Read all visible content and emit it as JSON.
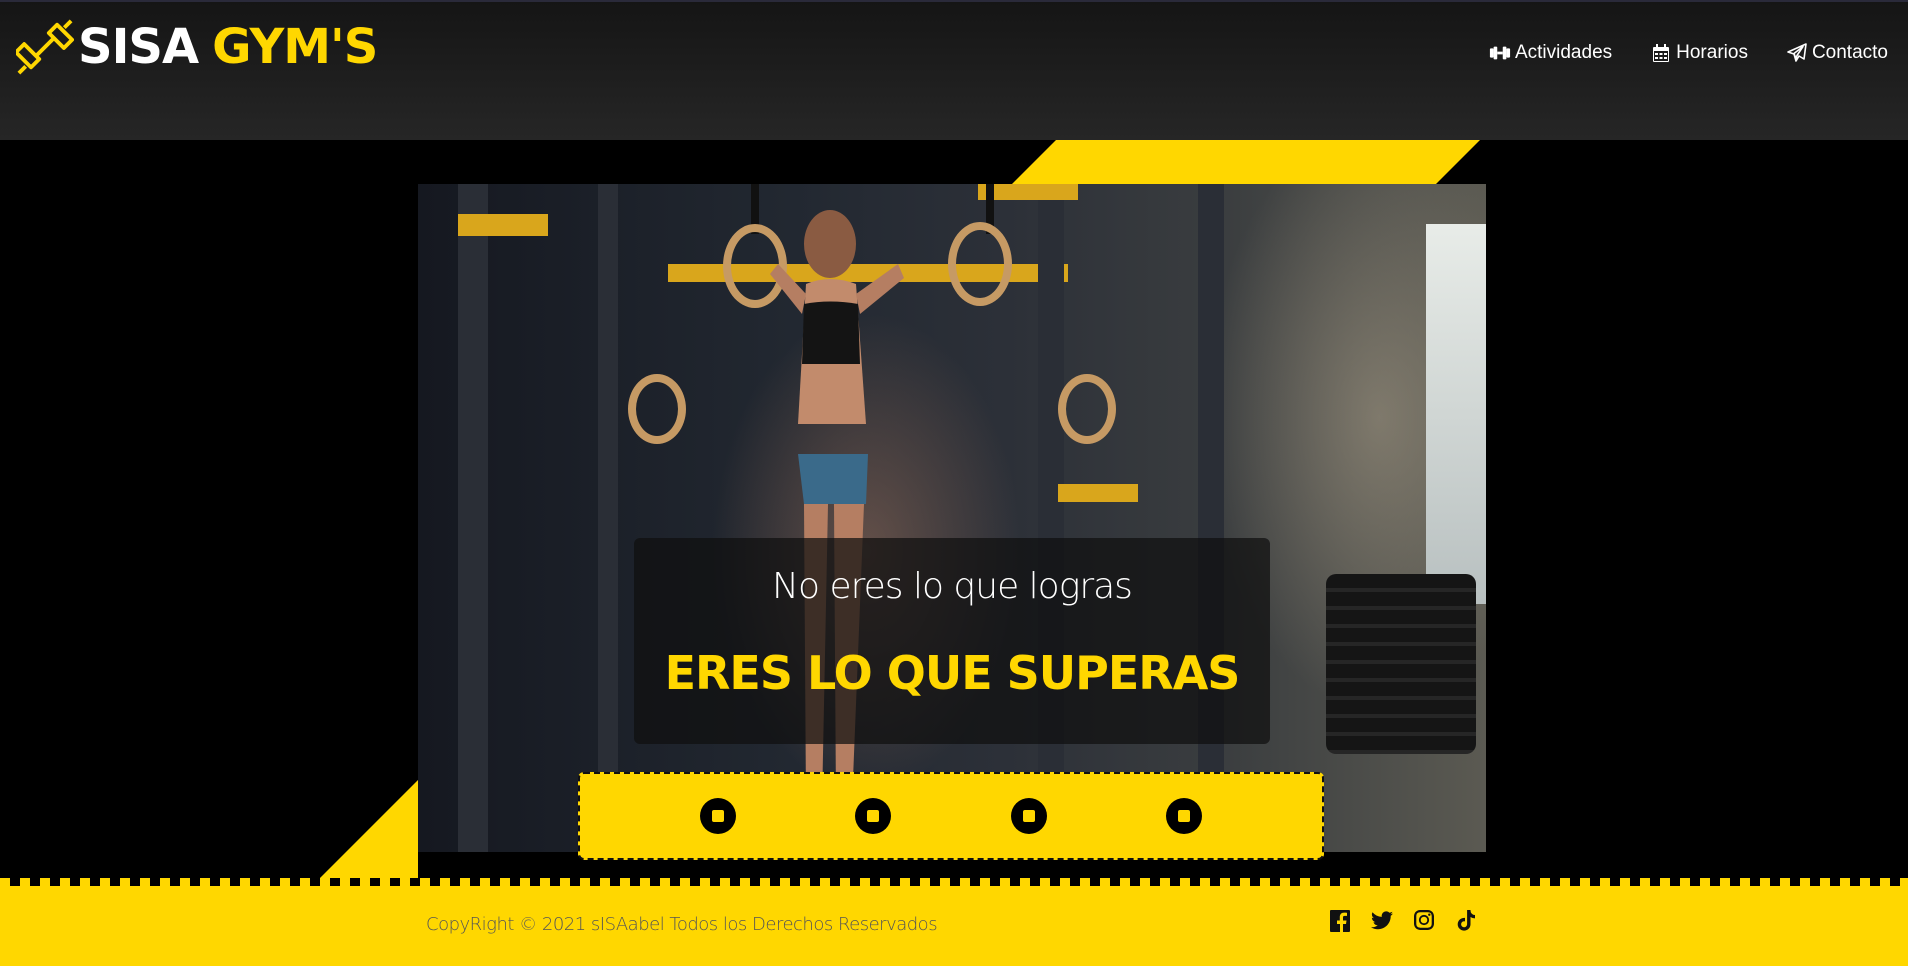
{
  "header": {
    "logo_primary": "SISA",
    "logo_secondary": "GYM'S",
    "logo_icon": "dumbbell-icon",
    "nav": [
      {
        "label": "Actividades",
        "icon": "dumbbell-icon"
      },
      {
        "label": "Horarios",
        "icon": "calendar-icon"
      },
      {
        "label": "Contacto",
        "icon": "paper-plane-icon"
      }
    ]
  },
  "hero": {
    "quote_line1": "No eres lo que logras",
    "quote_line2": "ERES LO QUE SUPERAS",
    "slide_indicators": 4
  },
  "footer": {
    "copyright": "CopyRight © 2021 sISAabel Todos los Derechos Reservados",
    "social": [
      "facebook-icon",
      "twitter-icon",
      "instagram-icon",
      "tiktok-icon"
    ]
  },
  "colors": {
    "accent": "#ffd700",
    "header_bg": "#1f1f1f",
    "page_bg": "#000000"
  }
}
